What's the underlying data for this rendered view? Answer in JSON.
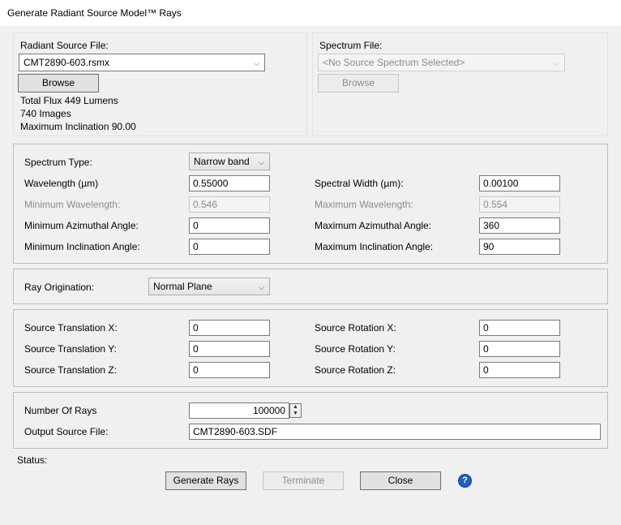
{
  "window": {
    "title": "Generate Radiant Source Model™ Rays"
  },
  "source": {
    "file_label": "Radiant Source File:",
    "file_value": "CMT2890-603.rsmx",
    "browse_label": "Browse",
    "flux": "Total Flux 449 Lumens",
    "images": "740 Images",
    "max_inclination": "Maximum Inclination 90.00"
  },
  "spectrum_file": {
    "label": "Spectrum File:",
    "value": "<No Source Spectrum Selected>",
    "browse_label": "Browse"
  },
  "spectrum": {
    "type_label": "Spectrum Type:",
    "type_value": "Narrow band",
    "wavelength_label": "Wavelength (µm)",
    "wavelength_value": "0.55000",
    "spectral_width_label": "Spectral Width (µm):",
    "spectral_width_value": "0.00100",
    "min_wavelength_label": "Minimum Wavelength:",
    "min_wavelength_value": "0.546",
    "max_wavelength_label": "Maximum Wavelength:",
    "max_wavelength_value": "0.554",
    "min_azimuth_label": "Minimum Azimuthal Angle:",
    "min_azimuth_value": "0",
    "max_azimuth_label": "Maximum Azimuthal Angle:",
    "max_azimuth_value": "360",
    "min_inclination_label": "Minimum Inclination Angle:",
    "min_inclination_value": "0",
    "max_inclination_label": "Maximum Inclination Angle:",
    "max_inclination_value": "90"
  },
  "origination": {
    "label": "Ray Origination:",
    "value": "Normal Plane"
  },
  "transform": {
    "tx_label": "Source Translation X:",
    "tx_value": "0",
    "ty_label": "Source Translation Y:",
    "ty_value": "0",
    "tz_label": "Source Translation Z:",
    "tz_value": "0",
    "rx_label": "Source Rotation X:",
    "rx_value": "0",
    "ry_label": "Source Rotation Y:",
    "ry_value": "0",
    "rz_label": "Source Rotation Z:",
    "rz_value": "0"
  },
  "output": {
    "rays_label": "Number Of Rays",
    "rays_value": "100000",
    "file_label": "Output Source File:",
    "file_value": "CMT2890-603.SDF"
  },
  "status": {
    "label": "Status:"
  },
  "buttons": {
    "generate": "Generate Rays",
    "terminate": "Terminate",
    "close": "Close",
    "help": "?"
  },
  "icons": {
    "dropdown": "chevron-down-icon",
    "spin_up": "spin-up-icon",
    "spin_down": "spin-down-icon",
    "help": "help-icon"
  }
}
